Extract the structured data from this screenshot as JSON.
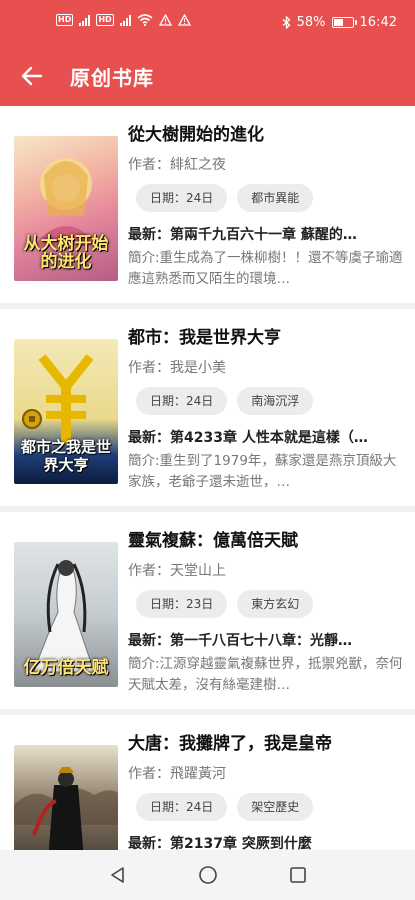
{
  "status_bar": {
    "hd1": "HD",
    "hd2": "HD",
    "battery_percent": 58,
    "battery_text": "58%",
    "time": "16:42"
  },
  "app_bar": {
    "back_icon": "arrow-left-icon",
    "title": "原创书库"
  },
  "colors": {
    "accent": "#e8504f",
    "tag_bg": "#ececec"
  },
  "books": [
    {
      "title": "從大樹開始的進化",
      "cover_title": "从大树开始的进化",
      "author": "作者：緋紅之夜",
      "date": "日期：24日",
      "category": "都市異能",
      "latest": "最新：第兩千九百六十一章 蘇醒的…",
      "intro": "簡介:重生成為了一株柳樹！！還不等虞子瑜適應這熟悉而又陌生的環境…"
    },
    {
      "title": "都市：我是世界大亨",
      "cover_title": "都市之我是世界大亨",
      "author": "作者：我是小美",
      "date": "日期：24日",
      "category": "南海沉浮",
      "latest": "最新：第4233章 人性本就是這樣（…",
      "intro": "簡介:重生到了1979年，蘇家還是燕京頂級大家族，老爺子還未逝世，…"
    },
    {
      "title": "靈氣複蘇：億萬倍天賦",
      "cover_title": "亿万倍天赋",
      "author": "作者：天堂山上",
      "date": "日期：23日",
      "category": "東方玄幻",
      "latest": "最新：第一千八百七十八章：光靜…",
      "intro": "簡介:江源穿越靈氣複蘇世界，抵禦兇獸，奈何天賦太差，沒有絲毫建樹…"
    },
    {
      "title": "大唐：我攤牌了，我是皇帝",
      "cover_title": "",
      "author": "作者：飛躍黃河",
      "date": "日期：24日",
      "category": "架空歷史",
      "latest": "最新：第2137章 突厥到什麼",
      "intro": ""
    }
  ],
  "nav_bar": {
    "back": "triangle-back-icon",
    "home": "circle-home-icon",
    "recents": "square-recents-icon"
  }
}
